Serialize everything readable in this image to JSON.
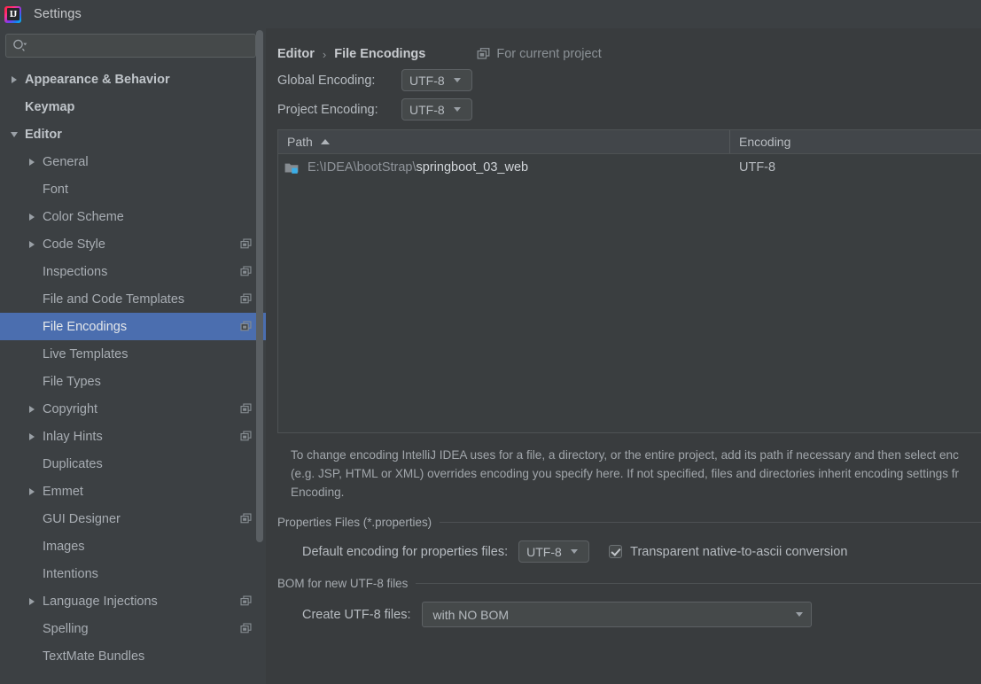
{
  "window": {
    "title": "Settings",
    "logo_icon": "intellij-idea-logo",
    "logo_text": "IJ"
  },
  "search": {
    "icon": "search-icon",
    "value": "",
    "placeholder": ""
  },
  "sidebar": {
    "project_icon": "project-settings-icon",
    "items": [
      {
        "label": "Appearance & Behavior",
        "level": 0,
        "twisty": "right",
        "bold": true,
        "project_icon": false,
        "selected": false
      },
      {
        "label": "Keymap",
        "level": 0,
        "twisty": "none",
        "bold": true,
        "project_icon": false,
        "selected": false
      },
      {
        "label": "Editor",
        "level": 0,
        "twisty": "down",
        "bold": true,
        "project_icon": false,
        "selected": false
      },
      {
        "label": "General",
        "level": 1,
        "twisty": "right",
        "bold": false,
        "project_icon": false,
        "selected": false
      },
      {
        "label": "Font",
        "level": 1,
        "twisty": "none",
        "bold": false,
        "project_icon": false,
        "selected": false
      },
      {
        "label": "Color Scheme",
        "level": 1,
        "twisty": "right",
        "bold": false,
        "project_icon": false,
        "selected": false
      },
      {
        "label": "Code Style",
        "level": 1,
        "twisty": "right",
        "bold": false,
        "project_icon": true,
        "selected": false
      },
      {
        "label": "Inspections",
        "level": 1,
        "twisty": "none",
        "bold": false,
        "project_icon": true,
        "selected": false
      },
      {
        "label": "File and Code Templates",
        "level": 1,
        "twisty": "none",
        "bold": false,
        "project_icon": true,
        "selected": false
      },
      {
        "label": "File Encodings",
        "level": 1,
        "twisty": "none",
        "bold": false,
        "project_icon": true,
        "selected": true
      },
      {
        "label": "Live Templates",
        "level": 1,
        "twisty": "none",
        "bold": false,
        "project_icon": false,
        "selected": false
      },
      {
        "label": "File Types",
        "level": 1,
        "twisty": "none",
        "bold": false,
        "project_icon": false,
        "selected": false
      },
      {
        "label": "Copyright",
        "level": 1,
        "twisty": "right",
        "bold": false,
        "project_icon": true,
        "selected": false
      },
      {
        "label": "Inlay Hints",
        "level": 1,
        "twisty": "right",
        "bold": false,
        "project_icon": true,
        "selected": false
      },
      {
        "label": "Duplicates",
        "level": 1,
        "twisty": "none",
        "bold": false,
        "project_icon": false,
        "selected": false
      },
      {
        "label": "Emmet",
        "level": 1,
        "twisty": "right",
        "bold": false,
        "project_icon": false,
        "selected": false
      },
      {
        "label": "GUI Designer",
        "level": 1,
        "twisty": "none",
        "bold": false,
        "project_icon": true,
        "selected": false
      },
      {
        "label": "Images",
        "level": 1,
        "twisty": "none",
        "bold": false,
        "project_icon": false,
        "selected": false
      },
      {
        "label": "Intentions",
        "level": 1,
        "twisty": "none",
        "bold": false,
        "project_icon": false,
        "selected": false
      },
      {
        "label": "Language Injections",
        "level": 1,
        "twisty": "right",
        "bold": false,
        "project_icon": true,
        "selected": false
      },
      {
        "label": "Spelling",
        "level": 1,
        "twisty": "none",
        "bold": false,
        "project_icon": true,
        "selected": false
      },
      {
        "label": "TextMate Bundles",
        "level": 1,
        "twisty": "none",
        "bold": false,
        "project_icon": false,
        "selected": false
      }
    ]
  },
  "main": {
    "breadcrumb": {
      "parent": "Editor",
      "separator": "›",
      "current": "File Encodings"
    },
    "for_current_project": {
      "icon": "project-settings-icon",
      "label": "For current project"
    },
    "global_encoding": {
      "label": "Global Encoding:",
      "value": "UTF-8"
    },
    "project_encoding": {
      "label": "Project Encoding:",
      "value": "UTF-8"
    },
    "table": {
      "columns": [
        {
          "label": "Path",
          "sort": "ascending",
          "sort_icon": "sort-ascending-icon"
        },
        {
          "label": "Encoding",
          "sort": "none",
          "sort_icon": ""
        }
      ],
      "rows": [
        {
          "icon": "module-folder-icon",
          "path_prefix": "E:\\IDEA\\bootStrap\\",
          "path_name": "springboot_03_web",
          "encoding": "UTF-8"
        }
      ]
    },
    "description": [
      "To change encoding IntelliJ IDEA uses for a file, a directory, or the entire project, add its path if necessary and then select enc",
      "(e.g. JSP, HTML or XML) overrides encoding you specify here. If not specified, files and directories inherit encoding settings fr",
      "Encoding."
    ],
    "properties_group": {
      "title": "Properties Files (*.properties)",
      "default_encoding_label": "Default encoding for properties files:",
      "default_encoding_value": "UTF-8",
      "transparent_checkbox": {
        "label": "Transparent native-to-ascii conversion",
        "checked": true
      }
    },
    "bom_group": {
      "title": "BOM for new UTF-8 files",
      "create_label": "Create UTF-8 files:",
      "create_value": "with NO BOM"
    }
  },
  "colors": {
    "window_bg": "#3c4043",
    "panel_bg": "#393c3e",
    "selection_blue": "#4b6eaf",
    "text_primary": "#b6bbc0",
    "text_dim": "#8f949a",
    "module_badge": "#3aaee8"
  }
}
